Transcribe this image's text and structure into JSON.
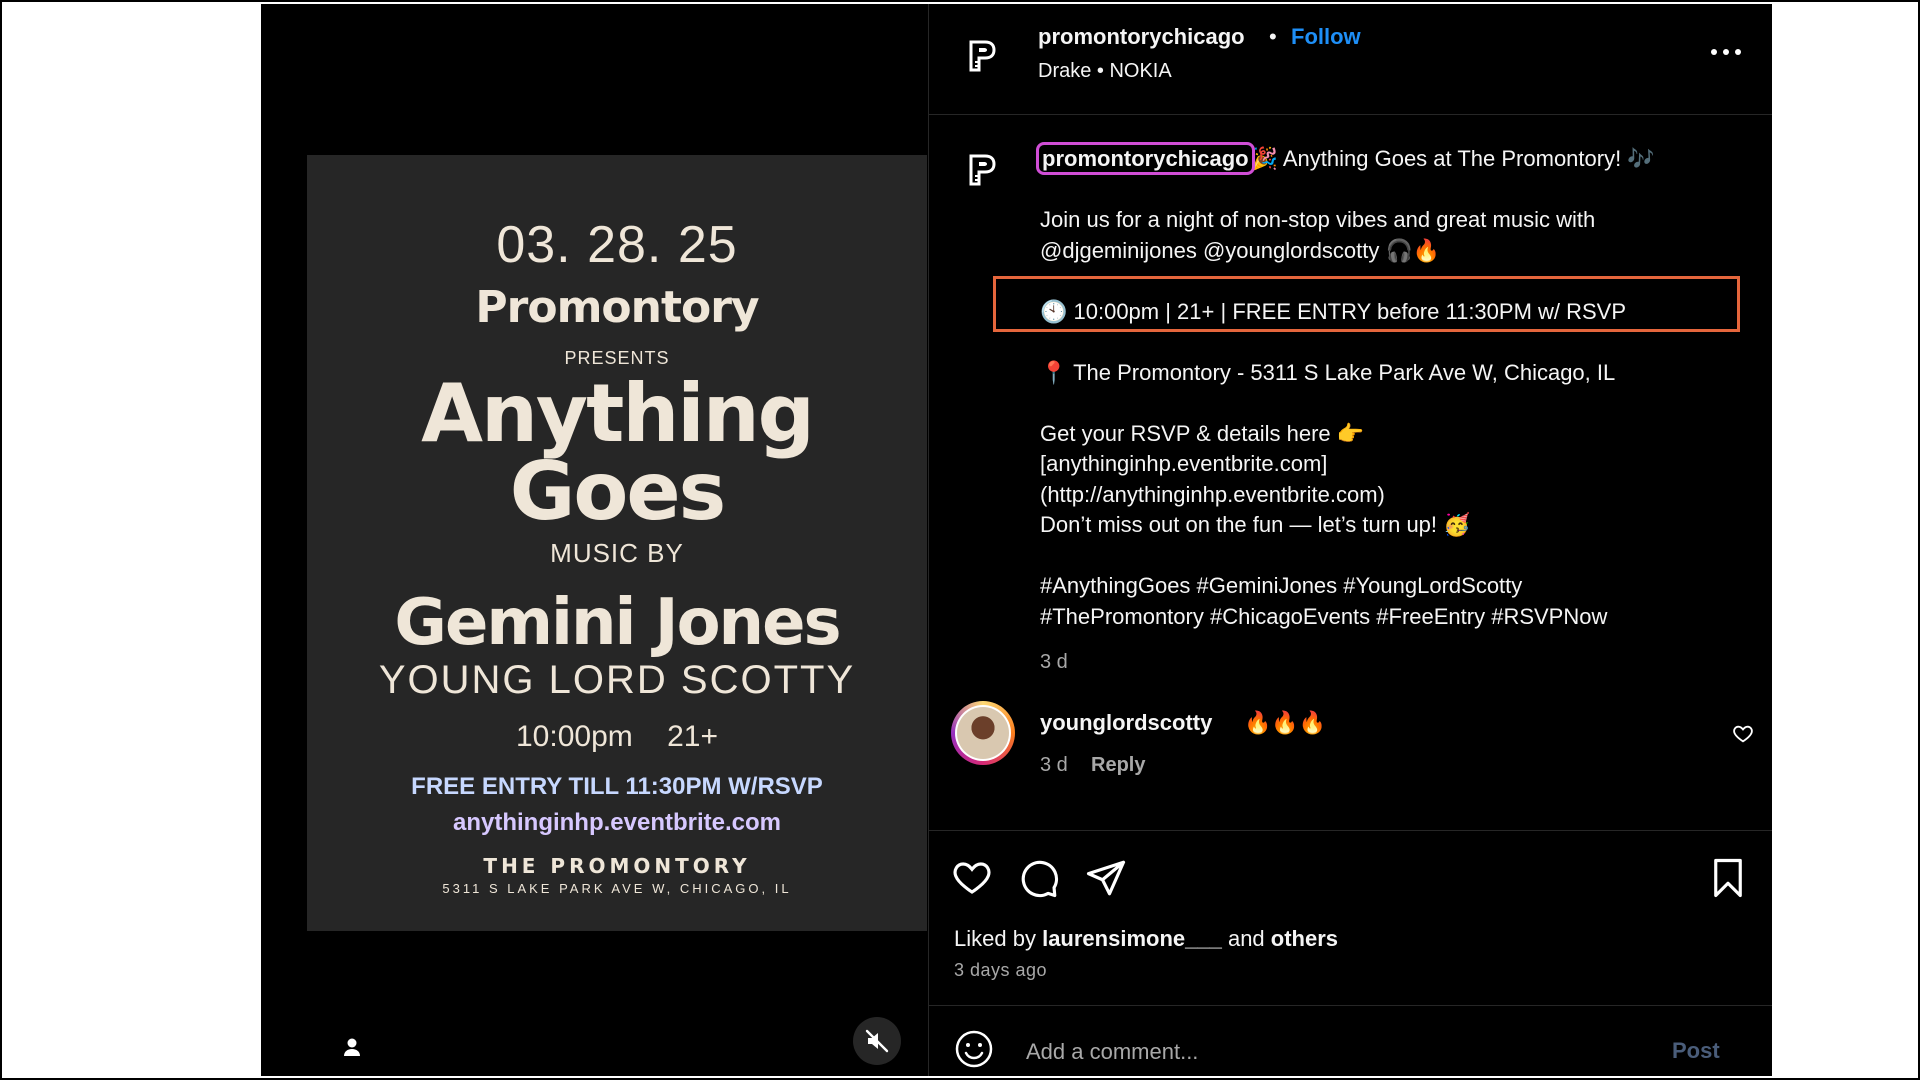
{
  "poster": {
    "date": "03. 28. 25",
    "brand": "Promontory",
    "presents": "PRESENTS",
    "title_line1": "Anything",
    "title_line2": "Goes",
    "music_by": "MUSIC BY",
    "headliner": "Gemini Jones",
    "support": "YOUNG LORD SCOTTY",
    "time_age": "10:00pm 21+",
    "free_entry": "FREE ENTRY TILL 11:30PM W/RSVP",
    "url": "anythinginhp.eventbrite.com",
    "venue": "THE PROMONTORY",
    "address": "5311 S LAKE PARK AVE W, CHICAGO, IL"
  },
  "header": {
    "username": "promontorychicago",
    "separator": "•",
    "follow_label": "Follow",
    "audio": "Drake • NOKIA"
  },
  "caption": {
    "username": "promontorychicago",
    "line1": "🎉 Anything Goes at The Promontory! 🎶",
    "line2": "Join us for a night of non-stop vibes and great music with",
    "line3": "@djgeminijones @younglordscotty 🎧🔥",
    "line4": "🕙 10:00pm | 21+ | FREE ENTRY before 11:30PM w/ RSVP",
    "line5": "📍 The Promontory - 5311 S Lake Park Ave W, Chicago, IL",
    "line6": "Get your RSVP & details here 👉",
    "line7": "[anythinginhp.eventbrite.com]",
    "line8": "(http://anythinginhp.eventbrite.com)",
    "line9": "Don’t miss out on the fun — let’s turn up! 🥳",
    "line10": "#AnythingGoes #GeminiJones #YoungLordScotty",
    "line11": "#ThePromontory #ChicagoEvents #FreeEntry #RSVPNow",
    "time": "3 d"
  },
  "comment": {
    "username": "younglordscotty",
    "text": "🔥🔥🔥",
    "time": "3 d",
    "reply_label": "Reply"
  },
  "likes": {
    "prefix": "Liked by",
    "user": "laurensimone___",
    "and": "and",
    "others": "others",
    "time_ago": "3 days ago"
  },
  "add_comment": {
    "placeholder": "Add a comment...",
    "post_label": "Post"
  },
  "colors": {
    "follow": "#1e8ff7",
    "highlight_box": "#e5663c",
    "username_outline": "#d04ed6"
  },
  "icons": [
    "logo-icon",
    "more-icon",
    "heart-icon",
    "comment-icon",
    "share-icon",
    "bookmark-icon",
    "emoji-icon",
    "user-tag-icon",
    "mute-icon"
  ]
}
